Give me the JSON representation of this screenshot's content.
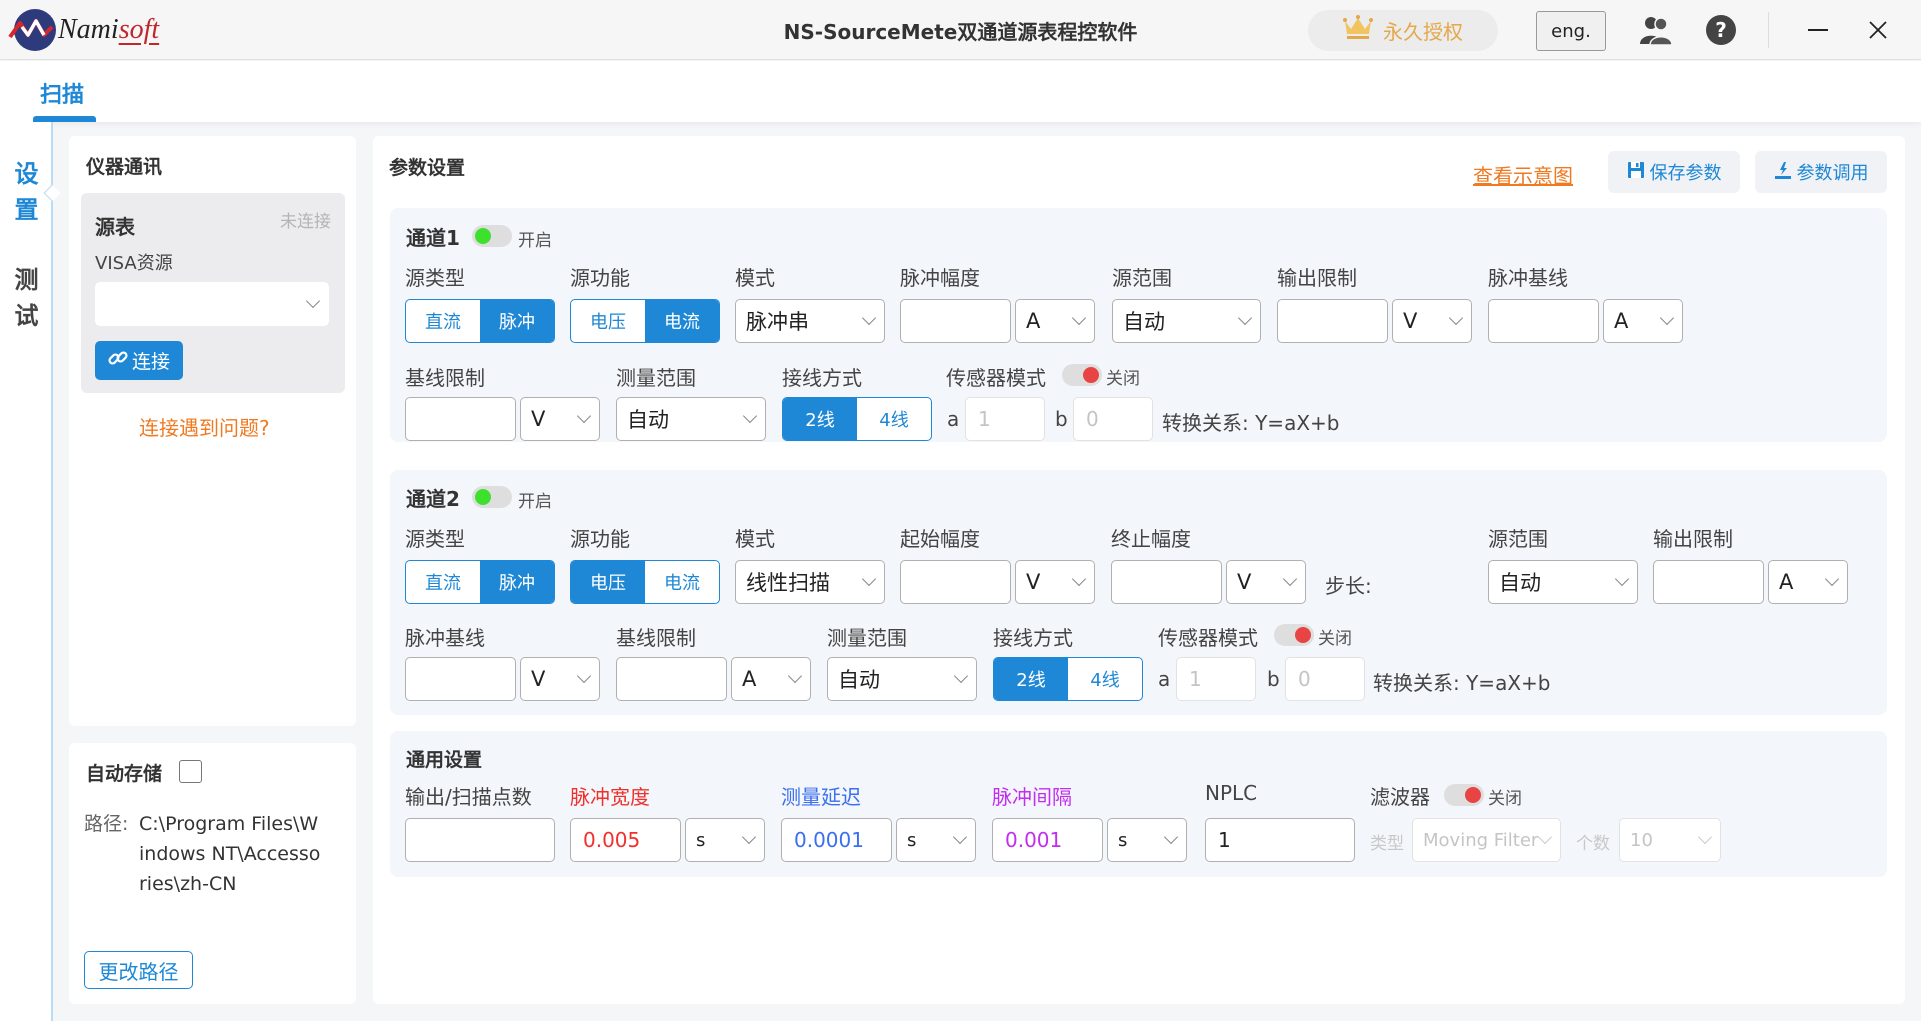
{
  "titlebar": {
    "logo_text_main": "Nami",
    "logo_text_accent": "soft",
    "title": "NS-SourceMete双通道源表程控软件",
    "license_label": "永久授权",
    "language_button": "eng.",
    "icons": {
      "license": "crown-icon",
      "users": "users-icon",
      "help": "help-icon",
      "minimize": "minimize-icon",
      "close": "close-icon"
    }
  },
  "tabs": [
    {
      "label": "扫描",
      "active": true
    }
  ],
  "vnav": [
    {
      "label": "设置",
      "chars": [
        "设",
        "置"
      ],
      "active": true
    },
    {
      "label": "测试",
      "chars": [
        "测",
        "试"
      ],
      "active": false
    }
  ],
  "instrument": {
    "title": "仪器通讯",
    "device_label": "源表",
    "status": "未连接",
    "visa_label": "VISA资源",
    "visa_value": "",
    "connect_button": "连接",
    "help_link": "连接遇到问题?"
  },
  "autosave": {
    "title": "自动存储",
    "checked": false,
    "path_label": "路径:",
    "path_lines": [
      "C:\\Program Files\\W",
      "indows NT\\Accesso",
      "ries\\zh-CN"
    ],
    "change_path_button": "更改路径"
  },
  "params": {
    "title": "参数设置",
    "view_diagram_link": "查看示意图",
    "save_button": "保存参数",
    "load_button": "参数调用"
  },
  "channel1": {
    "title": "通道1",
    "enabled": true,
    "enabled_label": "开启",
    "source_type": {
      "label": "源类型",
      "options": [
        "直流",
        "脉冲"
      ],
      "selected": "脉冲"
    },
    "source_function": {
      "label": "源功能",
      "options": [
        "电压",
        "电流"
      ],
      "selected": "电流"
    },
    "mode": {
      "label": "模式",
      "value": "脉冲串"
    },
    "pulse_amplitude": {
      "label": "脉冲幅度",
      "value": "",
      "unit": "A"
    },
    "source_range": {
      "label": "源范围",
      "value": "自动"
    },
    "output_limit": {
      "label": "输出限制",
      "value": "",
      "unit": "V"
    },
    "pulse_baseline": {
      "label": "脉冲基线",
      "value": "",
      "unit": "A"
    },
    "baseline_limit": {
      "label": "基线限制",
      "value": "",
      "unit": "V"
    },
    "measure_range": {
      "label": "测量范围",
      "value": "自动"
    },
    "wiring": {
      "label": "接线方式",
      "options": [
        "2线",
        "4线"
      ],
      "selected": "2线"
    },
    "sensor_mode": {
      "label": "传感器模式",
      "enabled": false,
      "state_label": "关闭"
    },
    "a_label": "a",
    "a_value": "1",
    "b_label": "b",
    "b_value": "0",
    "relation": "转换关系: Y=aX+b"
  },
  "channel2": {
    "title": "通道2",
    "enabled": true,
    "enabled_label": "开启",
    "source_type": {
      "label": "源类型",
      "options": [
        "直流",
        "脉冲"
      ],
      "selected": "脉冲"
    },
    "source_function": {
      "label": "源功能",
      "options": [
        "电压",
        "电流"
      ],
      "selected": "电压"
    },
    "mode": {
      "label": "模式",
      "value": "线性扫描"
    },
    "start_amplitude": {
      "label": "起始幅度",
      "value": "",
      "unit": "V"
    },
    "stop_amplitude": {
      "label": "终止幅度",
      "value": "",
      "unit": "V"
    },
    "step_label": "步长:",
    "source_range": {
      "label": "源范围",
      "value": "自动"
    },
    "output_limit": {
      "label": "输出限制",
      "value": "",
      "unit": "A"
    },
    "pulse_baseline": {
      "label": "脉冲基线",
      "value": "",
      "unit": "V"
    },
    "baseline_limit": {
      "label": "基线限制",
      "value": "",
      "unit": "A"
    },
    "measure_range": {
      "label": "测量范围",
      "value": "自动"
    },
    "wiring": {
      "label": "接线方式",
      "options": [
        "2线",
        "4线"
      ],
      "selected": "2线"
    },
    "sensor_mode": {
      "label": "传感器模式",
      "enabled": false,
      "state_label": "关闭"
    },
    "a_label": "a",
    "a_value": "1",
    "b_label": "b",
    "b_value": "0",
    "relation": "转换关系: Y=aX+b"
  },
  "general": {
    "title": "通用设置",
    "points": {
      "label": "输出/扫描点数",
      "value": ""
    },
    "pulse_width": {
      "label": "脉冲宽度",
      "value": "0.005",
      "unit": "s",
      "color": "#f0302c"
    },
    "measure_delay": {
      "label": "测量延迟",
      "value": "0.0001",
      "unit": "s",
      "color": "#3a6ff0"
    },
    "pulse_interval": {
      "label": "脉冲间隔",
      "value": "0.001",
      "unit": "s",
      "color": "#c22ef0"
    },
    "nplc": {
      "label": "NPLC",
      "value": "1"
    },
    "filter": {
      "label": "滤波器",
      "enabled": false,
      "state_label": "关闭",
      "type_label": "类型",
      "type_value": "Moving Filter",
      "count_label": "个数",
      "count_value": "10"
    }
  },
  "colors": {
    "accent": "#1e88d6",
    "link": "#f07a22",
    "toggle_on": "#3ee02e",
    "toggle_off": "#e84444"
  }
}
